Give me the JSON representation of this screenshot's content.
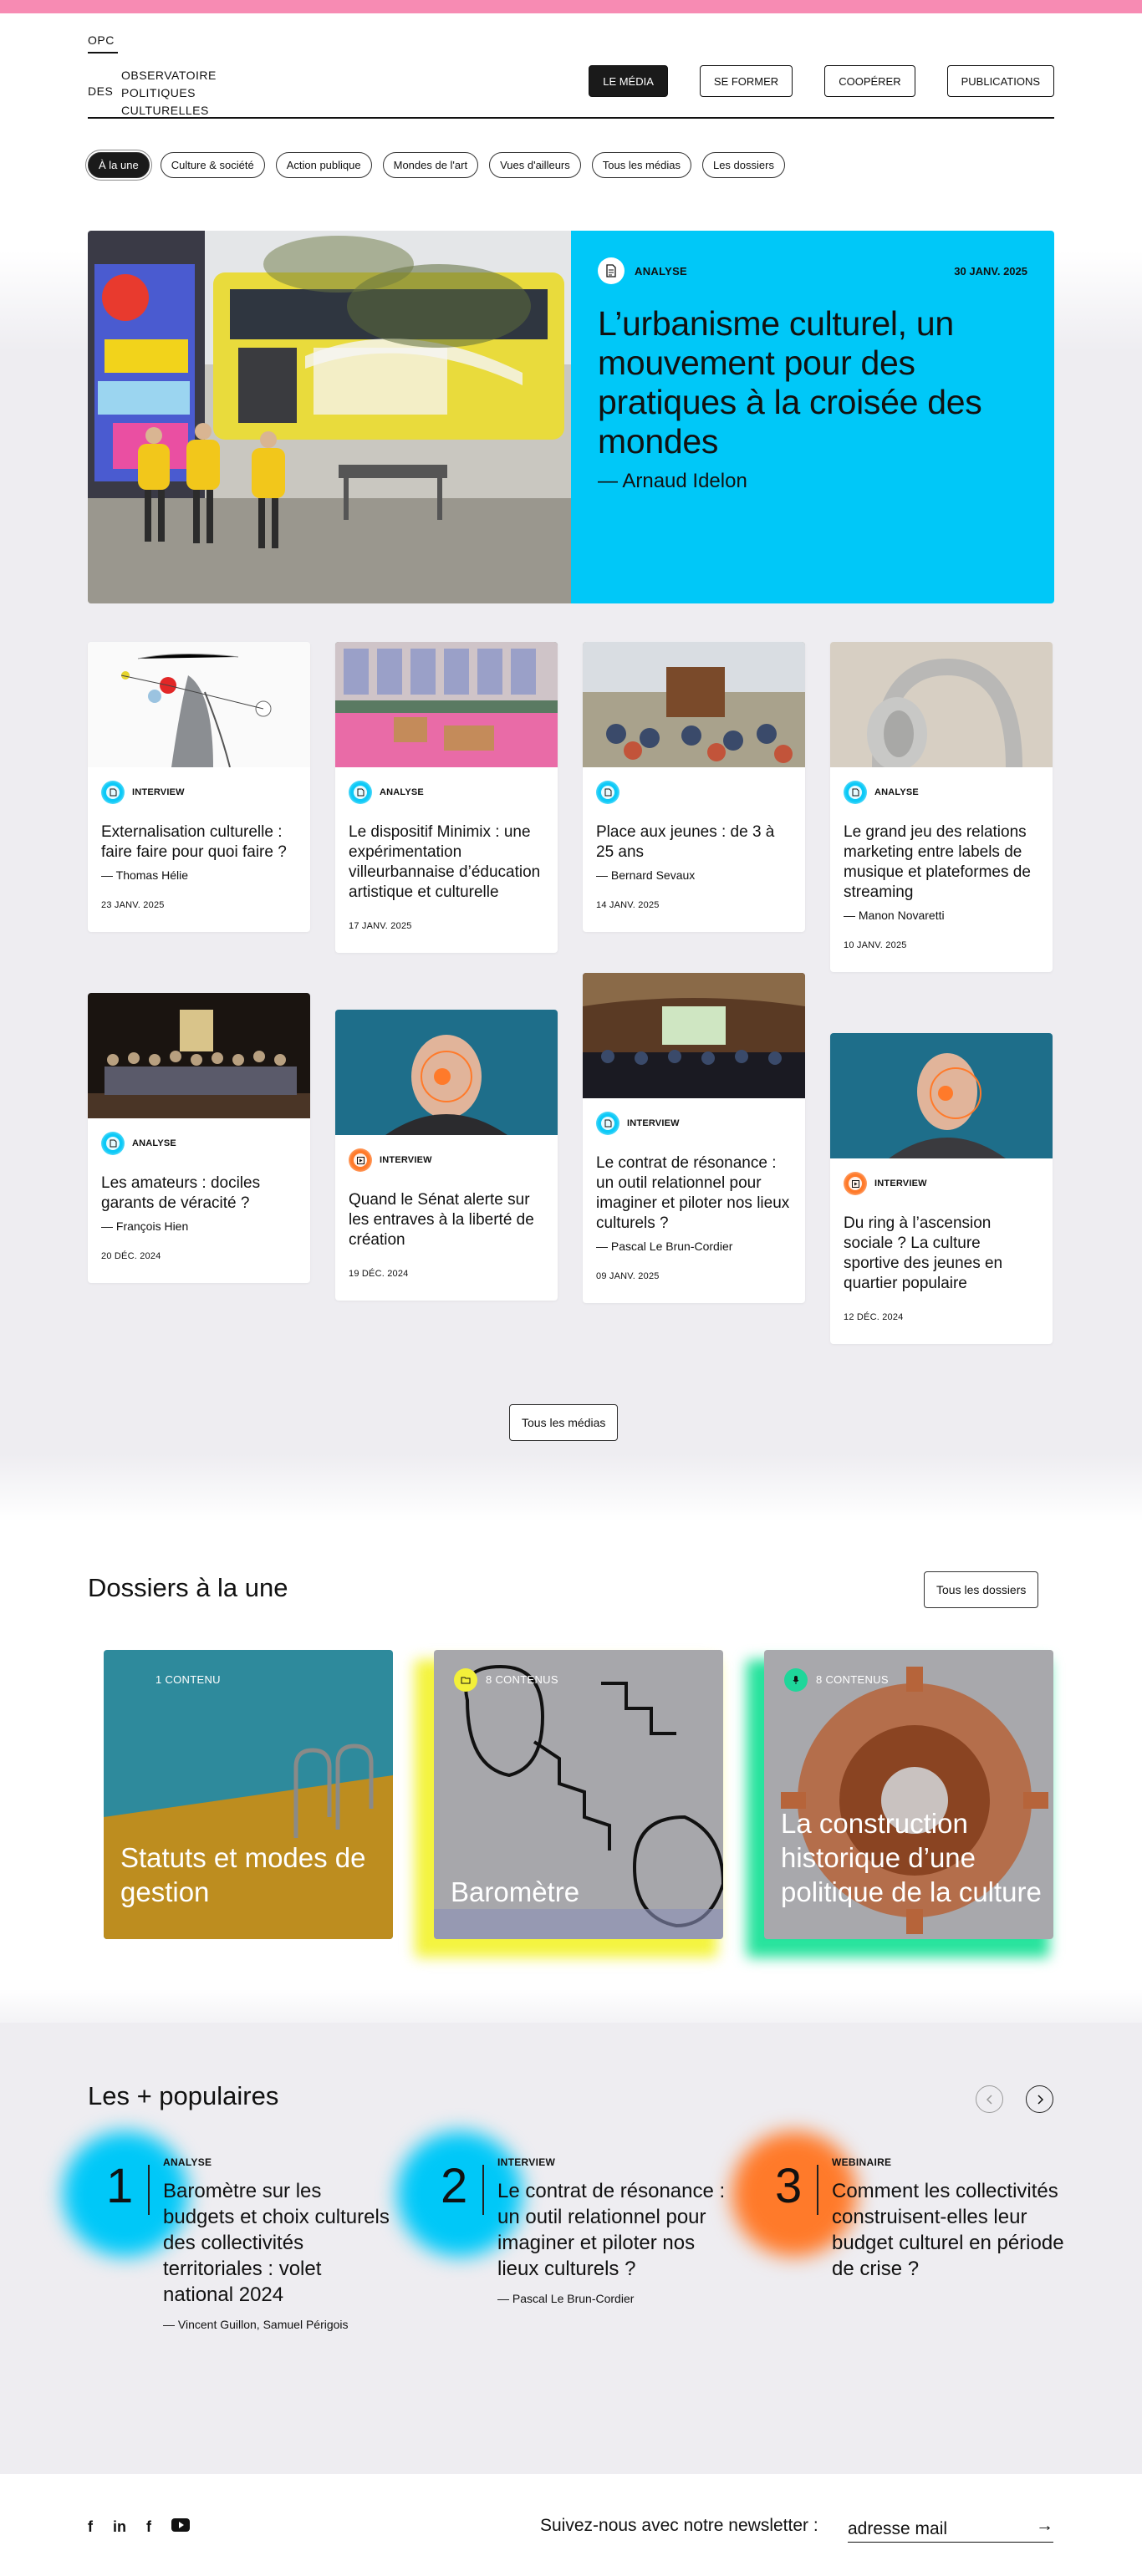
{
  "header": {
    "logo_short": "OPC",
    "logo_des": "DES",
    "logo_lines": "Observatoire\nPolitiques\nCulturelles",
    "nav": [
      {
        "label": "LE MÉDIA",
        "active": true
      },
      {
        "label": "SE FORMER"
      },
      {
        "label": "COOPÉRER"
      },
      {
        "label": "PUBLICATIONS"
      }
    ]
  },
  "filters": [
    {
      "label": "À la une",
      "active": true
    },
    {
      "label": "Culture & société"
    },
    {
      "label": "Action publique"
    },
    {
      "label": "Mondes de l'art"
    },
    {
      "label": "Vues d'ailleurs"
    },
    {
      "label": "Tous les médias"
    },
    {
      "label": "Les dossiers"
    }
  ],
  "hero": {
    "type": "ANALYSE",
    "date": "30 JANV. 2025",
    "title": "L’urbanisme culturel, un mouvement pour des pratiques à la croisée des mondes",
    "author": "— Arnaud Idelon"
  },
  "cards": [
    {
      "type": "INTERVIEW",
      "title": "Externalisation culturelle : faire faire pour quoi faire ?",
      "author": "— Thomas Hélie",
      "date": "23 JANV. 2025"
    },
    {
      "type": "ANALYSE",
      "title": "Le dispositif Minimix : une expérimentation villeurbannaise d’éducation artistique et culturelle",
      "author": "",
      "date": "17 JANV. 2025"
    },
    {
      "type": "",
      "title": "Place aux jeunes : de 3 à 25 ans",
      "author": "— Bernard Sevaux",
      "date": "14 JANV. 2025"
    },
    {
      "type": "ANALYSE",
      "title": "Le grand jeu des relations marketing entre labels de musique et plateformes de streaming",
      "author": "— Manon Novaretti",
      "date": "10 JANV. 2025"
    },
    {
      "type": "ANALYSE",
      "title": "Les amateurs : dociles garants de véracité ?",
      "author": "— François Hien",
      "date": "20 DÉC. 2024"
    },
    {
      "type": "INTERVIEW",
      "title": "Quand le Sénat alerte sur les entraves à la liberté de création",
      "author": "",
      "date": "19 DÉC. 2024"
    },
    {
      "type": "INTERVIEW",
      "title": "Le contrat de résonance : un outil relationnel pour imaginer et piloter nos lieux culturels ?",
      "author": "— Pascal Le Brun-Cordier",
      "date": "09 JANV. 2025"
    },
    {
      "type": "INTERVIEW",
      "title": "Du ring à l’ascension sociale ? La culture sportive des jeunes en quartier populaire",
      "author": "",
      "date": "12 DÉC. 2024"
    }
  ],
  "all_media_label": "Tous les médias",
  "dossiers": {
    "title": "Dossiers à la une",
    "all_label": "Tous les dossiers",
    "items": [
      {
        "count": "1 CONTENU",
        "title": "Statuts et modes de gestion"
      },
      {
        "count": "8 CONTENUS",
        "title": "Baromètre"
      },
      {
        "count": "8 CONTENUS",
        "title": "La construction historique d’une politique de la culture"
      }
    ]
  },
  "popular": {
    "title": "Les + populaires",
    "items": [
      {
        "num": "1",
        "type": "ANALYSE",
        "title": "Baromètre sur les budgets et choix culturels des collectivités territoriales : volet national 2024",
        "author": "— Vincent Guillon, Samuel Périgois",
        "color": "#00c8f8"
      },
      {
        "num": "2",
        "type": "INTERVIEW",
        "title": "Le contrat de résonance : un outil relationnel pour imaginer et piloter nos lieux culturels ?",
        "author": "— Pascal Le Brun-Cordier",
        "color": "#00c8f8"
      },
      {
        "num": "3",
        "type": "WEBINAIRE",
        "title": "Comment les collectivités construisent-elles leur budget culturel en période de crise ?",
        "author": "",
        "color": "#ff7a2a"
      }
    ]
  },
  "footer": {
    "newsletter_label": "Suivez-nous avec notre newsletter :",
    "email_placeholder": "adresse mail",
    "social": [
      "facebook-icon",
      "linkedin-icon",
      "facebook-icon",
      "youtube-icon"
    ]
  },
  "colors": {
    "accent_blue": "#00c8f8",
    "accent_orange": "#ff7a2a",
    "accent_yellow": "#f4f43f",
    "accent_green": "#27e39d",
    "top_bar": "#f78bb3"
  }
}
